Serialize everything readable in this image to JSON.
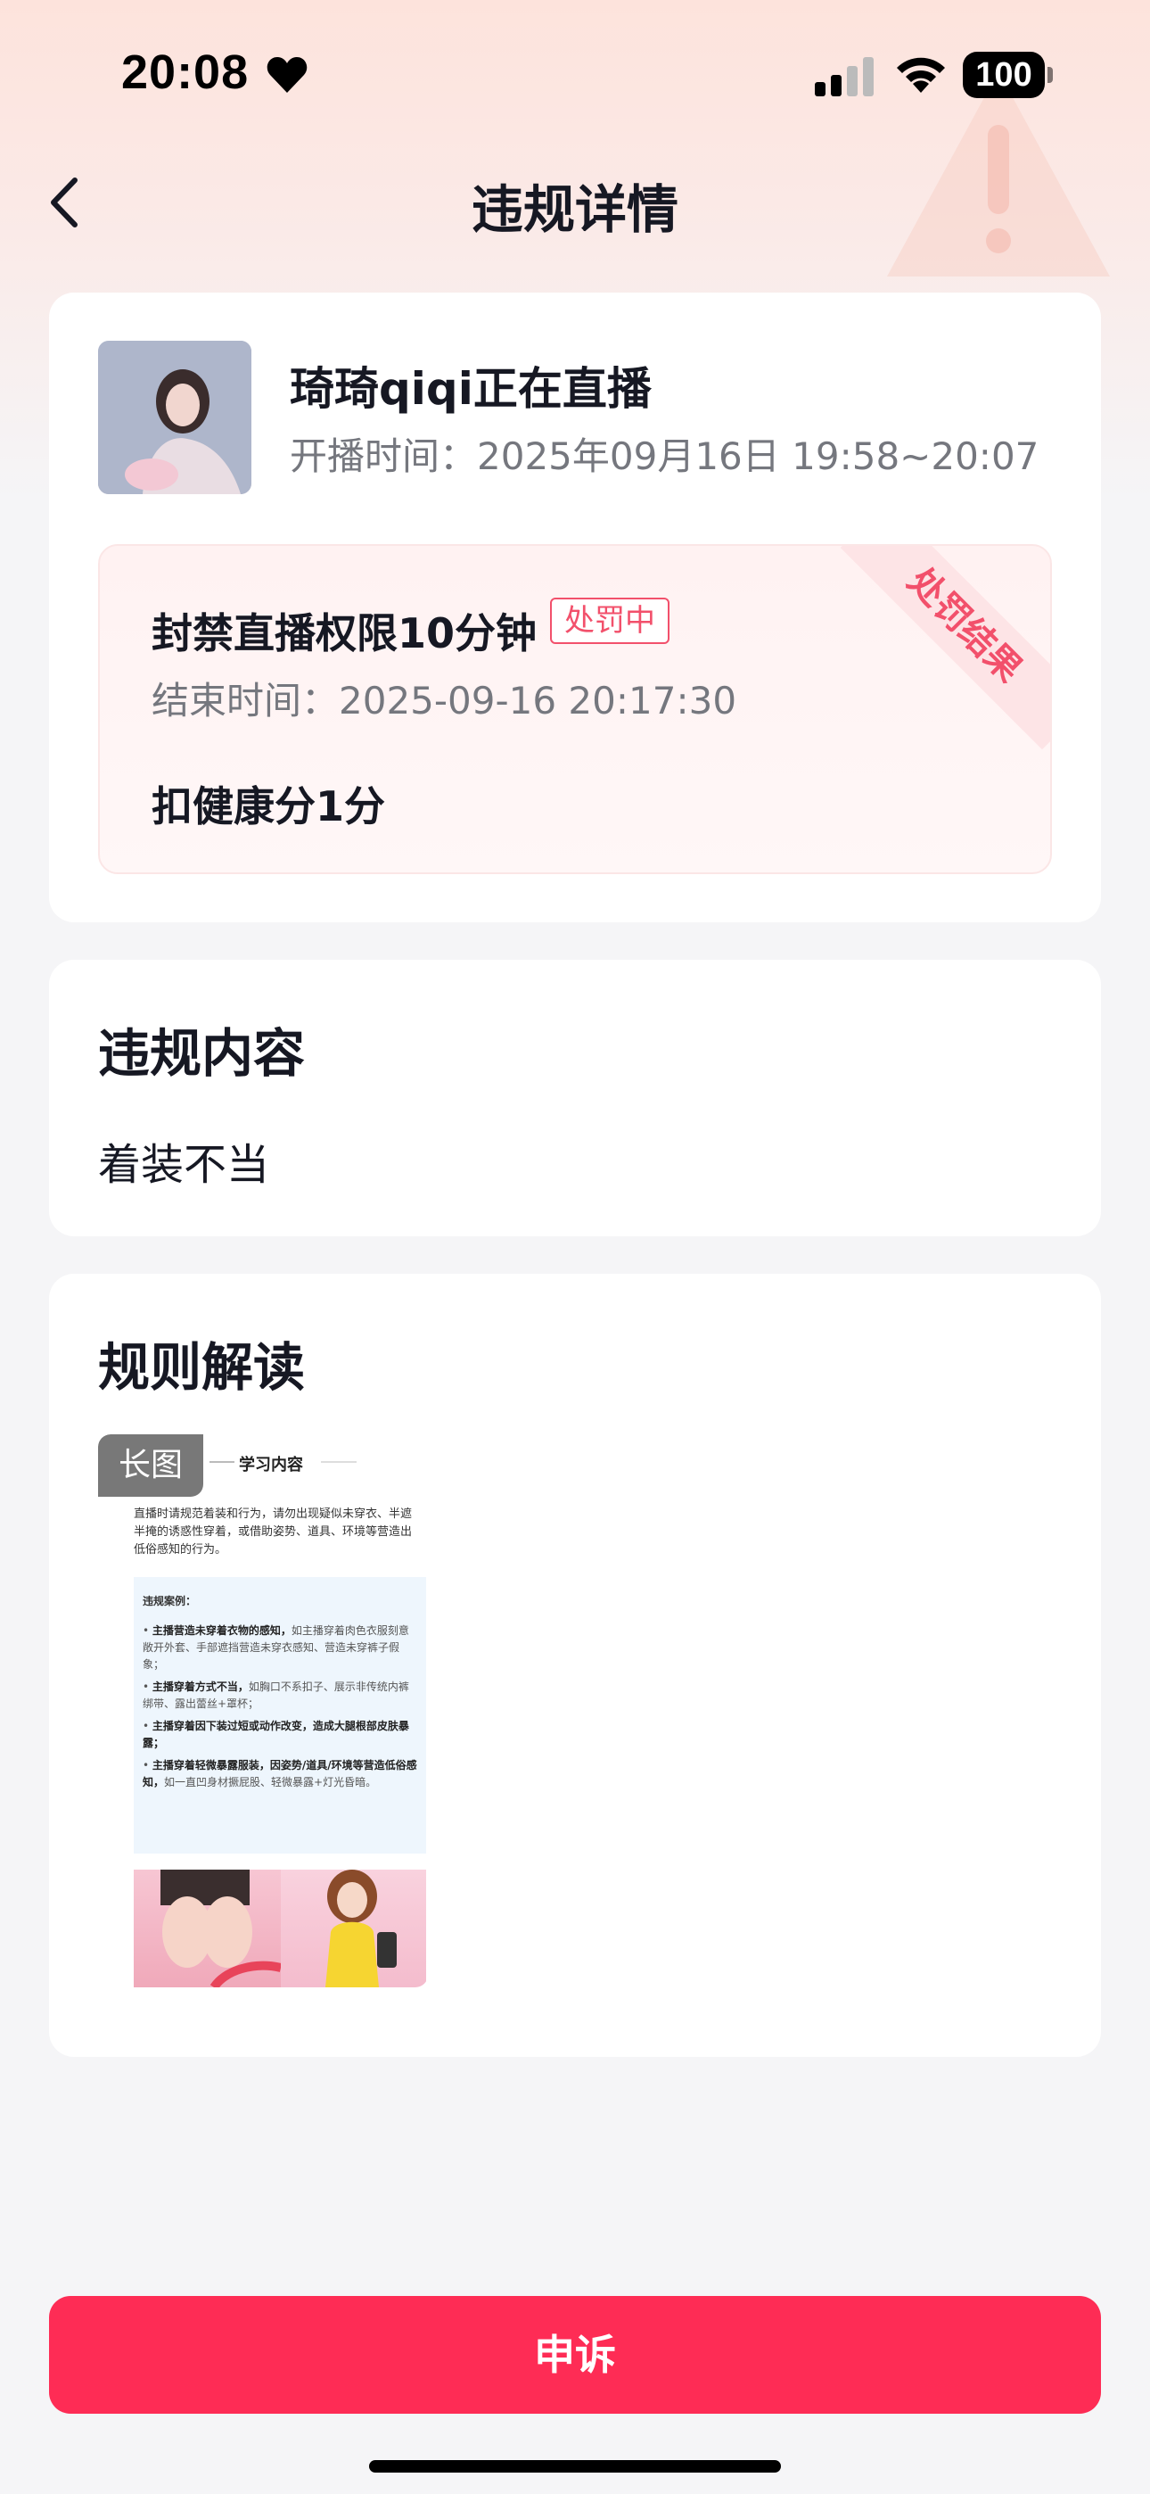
{
  "status_bar": {
    "time": "20:08",
    "battery": "100",
    "icons": [
      "heart-icon",
      "signal-icon",
      "wifi-icon",
      "battery-icon"
    ]
  },
  "nav": {
    "title": "违规详情",
    "back_icon": "chevron-left-icon"
  },
  "live_info": {
    "streamer": "琦琦qiqi正在直播",
    "start_time": "开播时间：2025年09月16日 19:58~20:07"
  },
  "penalty": {
    "ribbon": "处罚结果",
    "title": "封禁直播权限10分钟",
    "badge": "处罚中",
    "end_time": "结束时间：2025-09-16 20:17:30",
    "health": "扣健康分1分"
  },
  "violation": {
    "title": "违规内容",
    "content": "着装不当"
  },
  "rules": {
    "title": "规则解读",
    "tag": "长图",
    "thumb_heading": "学习内容",
    "thumb_intro": "直播时请规范着装和行为，请勿出现疑似未穿衣、半遮半掩的诱惑性穿着，或借助姿势、道具、环境等营造出低俗感知的行为。",
    "cases_title": "违规案例：",
    "cases": [
      {
        "bold": "主播营造未穿着衣物的感知，",
        "text": "如主播穿着肉色衣服刻意敞开外套、手部遮挡营造未穿衣感知、营造未穿裤子假象；"
      },
      {
        "bold": "主播穿着方式不当，",
        "text": "如胸口不系扣子、展示非传统内裤绑带、露出蕾丝+罩杯；"
      },
      {
        "bold": "主播穿着因下装过短或动作改变，造成大腿根部皮肤暴露；",
        "text": ""
      },
      {
        "bold": "主播穿着轻微暴露服装，因姿势/道具/环境等营造低俗感知，",
        "text": "如一直凹身材撅屁股、轻微暴露+灯光昏暗。"
      }
    ]
  },
  "action": {
    "appeal": "申诉"
  },
  "colors": {
    "accent": "#fe2c55",
    "penalty_red": "#f2506b",
    "background": "#f5f5f7"
  }
}
